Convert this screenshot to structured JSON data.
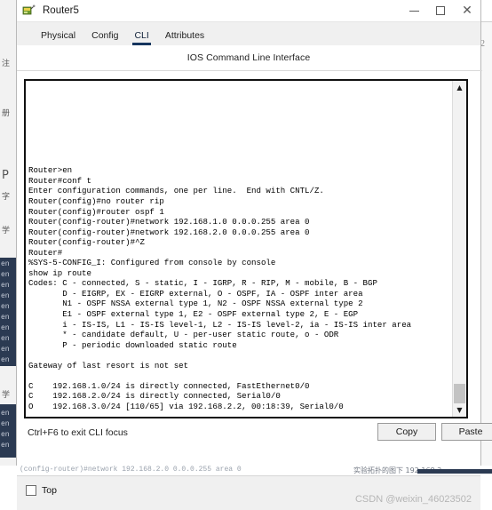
{
  "window": {
    "title": "Router5",
    "icon": "router-device-icon",
    "controls": {
      "minimize": "minimize-icon",
      "maximize": "maximize-icon",
      "close": "close-icon"
    }
  },
  "tabs": [
    {
      "label": "Physical",
      "active": false
    },
    {
      "label": "Config",
      "active": false
    },
    {
      "label": "CLI",
      "active": true
    },
    {
      "label": "Attributes",
      "active": false
    }
  ],
  "panel": {
    "title": "IOS Command Line Interface"
  },
  "terminal": {
    "leading_blank_lines": 8,
    "lines": [
      "Router>en",
      "Router#conf t",
      "Enter configuration commands, one per line.  End with CNTL/Z.",
      "Router(config)#no router rip",
      "Router(config)#router ospf 1",
      "Router(config-router)#network 192.168.1.0 0.0.0.255 area 0",
      "Router(config-router)#network 192.168.2.0 0.0.0.255 area 0",
      "Router(config-router)#^Z",
      "Router#",
      "%SYS-5-CONFIG_I: Configured from console by console",
      "show ip route",
      "Codes: C - connected, S - static, I - IGRP, R - RIP, M - mobile, B - BGP",
      "       D - EIGRP, EX - EIGRP external, O - OSPF, IA - OSPF inter area",
      "       N1 - OSPF NSSA external type 1, N2 - OSPF NSSA external type 2",
      "       E1 - OSPF external type 1, E2 - OSPF external type 2, E - EGP",
      "       i - IS-IS, L1 - IS-IS level-1, L2 - IS-IS level-2, ia - IS-IS inter area",
      "       * - candidate default, U - per-user static route, o - ODR",
      "       P - periodic downloaded static route",
      "",
      "Gateway of last resort is not set",
      "",
      "C    192.168.1.0/24 is directly connected, FastEthernet0/0",
      "C    192.168.2.0/24 is directly connected, Serial0/0",
      "O    192.168.3.0/24 [110/65] via 192.168.2.2, 00:18:39, Serial0/0",
      ""
    ],
    "prompt": "Router#",
    "scrollbar": {
      "up_arrow": "chevron-up-icon",
      "down_arrow": "chevron-down-icon"
    }
  },
  "footer": {
    "hint": "Ctrl+F6 to exit CLI focus",
    "copy_label": "Copy",
    "paste_label": "Paste"
  },
  "bottom": {
    "top_label": "Top",
    "top_checked": false,
    "watermark": "CSDN @weixin_46023502"
  },
  "background": {
    "left_lines": [
      "en",
      "en",
      "en",
      "en",
      "en",
      "en",
      "en",
      "en",
      "en",
      "en"
    ],
    "left_lines2": [
      "en",
      "en",
      "en",
      "en"
    ],
    "left_cjk": [
      "注",
      "册",
      "字",
      "学"
    ],
    "left_p": "P",
    "right_mark": "2",
    "bottom_text": "(config-router)#network 192.168.2.0 0.0.0.255 area 0",
    "bottom_cjk": "实验拓扑的图下 192.168.3"
  },
  "colors": {
    "accent": "#16355e",
    "terminal_border": "#111111",
    "tabbar_bg": "#f0f0f0",
    "scroll_thumb": "#c3c3c3",
    "watermark": "#b6b6b6"
  }
}
